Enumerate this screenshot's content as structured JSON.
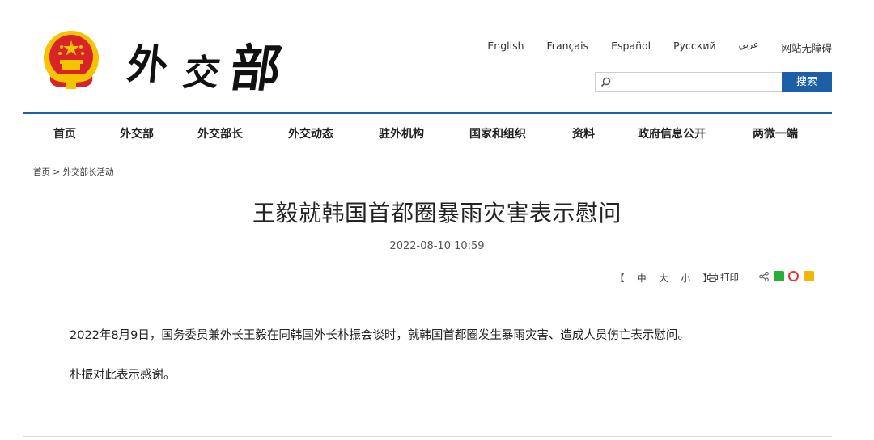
{
  "header": {
    "logo_chars": [
      "外",
      "交",
      "部"
    ],
    "languages": [
      "English",
      "Français",
      "Español",
      "Русский",
      "عربي",
      "网站无障碍"
    ],
    "search": {
      "placeholder": "",
      "value": "",
      "button_label": "搜索"
    }
  },
  "nav": {
    "items": [
      "首页",
      "外交部",
      "外交部长",
      "外交动态",
      "驻外机构",
      "国家和组织",
      "资料",
      "政府信息公开",
      "两微一端"
    ]
  },
  "breadcrumb": {
    "home": "首页",
    "separator": ">",
    "current": "外交部长活动"
  },
  "article": {
    "title": "王毅就韩国首都圈暴雨灾害表示慰问",
    "date": "2022-08-10 10:59",
    "paragraphs": [
      "2022年8月9日，国务委员兼外长王毅在同韩国外长朴振会谈时，就韩国首都圈发生暴雨灾害、造成人员伤亡表示慰问。",
      "朴振对此表示感谢。"
    ]
  },
  "tools": {
    "font_size_label": "【 中 大 小 】",
    "print_label": "打印"
  },
  "colors": {
    "accent": "#1d5fa6",
    "emblem_red": "#d8232a",
    "emblem_gold": "#f5c400"
  },
  "icons": [
    "search-icon",
    "print-icon",
    "share-icon",
    "wechat-icon",
    "weibo-icon",
    "qzone-icon"
  ]
}
